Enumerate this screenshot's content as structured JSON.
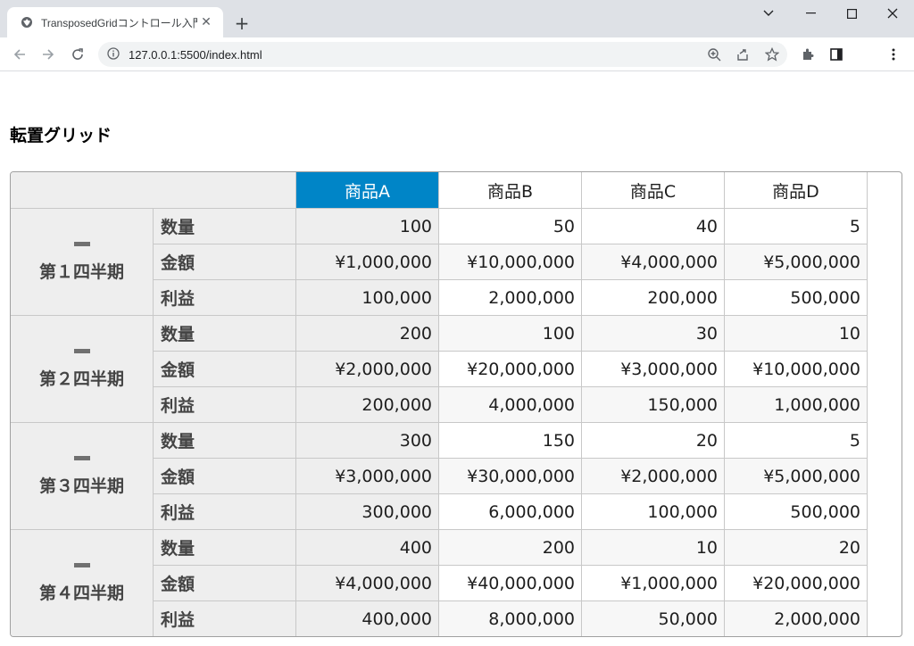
{
  "browser": {
    "tab_title": "TransposedGridコントロール入門",
    "url": "127.0.0.1:5500/index.html"
  },
  "page": {
    "heading": "転置グリッド"
  },
  "grid": {
    "columns": [
      "商品A",
      "商品B",
      "商品C",
      "商品D"
    ],
    "selected_column": 0,
    "groups": [
      {
        "label": "第１四半期",
        "rows": [
          {
            "header": "数量",
            "values": [
              "100",
              "50",
              "40",
              "5"
            ]
          },
          {
            "header": "金額",
            "values": [
              "¥1,000,000",
              "¥10,000,000",
              "¥4,000,000",
              "¥5,000,000"
            ]
          },
          {
            "header": "利益",
            "values": [
              "100,000",
              "2,000,000",
              "200,000",
              "500,000"
            ]
          }
        ]
      },
      {
        "label": "第２四半期",
        "rows": [
          {
            "header": "数量",
            "values": [
              "200",
              "100",
              "30",
              "10"
            ]
          },
          {
            "header": "金額",
            "values": [
              "¥2,000,000",
              "¥20,000,000",
              "¥3,000,000",
              "¥10,000,000"
            ]
          },
          {
            "header": "利益",
            "values": [
              "200,000",
              "4,000,000",
              "150,000",
              "1,000,000"
            ]
          }
        ]
      },
      {
        "label": "第３四半期",
        "rows": [
          {
            "header": "数量",
            "values": [
              "300",
              "150",
              "20",
              "5"
            ]
          },
          {
            "header": "金額",
            "values": [
              "¥3,000,000",
              "¥30,000,000",
              "¥2,000,000",
              "¥5,000,000"
            ]
          },
          {
            "header": "利益",
            "values": [
              "300,000",
              "6,000,000",
              "100,000",
              "500,000"
            ]
          }
        ]
      },
      {
        "label": "第４四半期",
        "rows": [
          {
            "header": "数量",
            "values": [
              "400",
              "200",
              "10",
              "20"
            ]
          },
          {
            "header": "金額",
            "values": [
              "¥4,000,000",
              "¥40,000,000",
              "¥1,000,000",
              "¥20,000,000"
            ]
          },
          {
            "header": "利益",
            "values": [
              "400,000",
              "8,000,000",
              "50,000",
              "2,000,000"
            ]
          }
        ]
      }
    ]
  },
  "colors": {
    "selected_header": "#0085c7",
    "header_bg": "#eeeeee",
    "alt_row_bg": "#f7f7f7"
  }
}
